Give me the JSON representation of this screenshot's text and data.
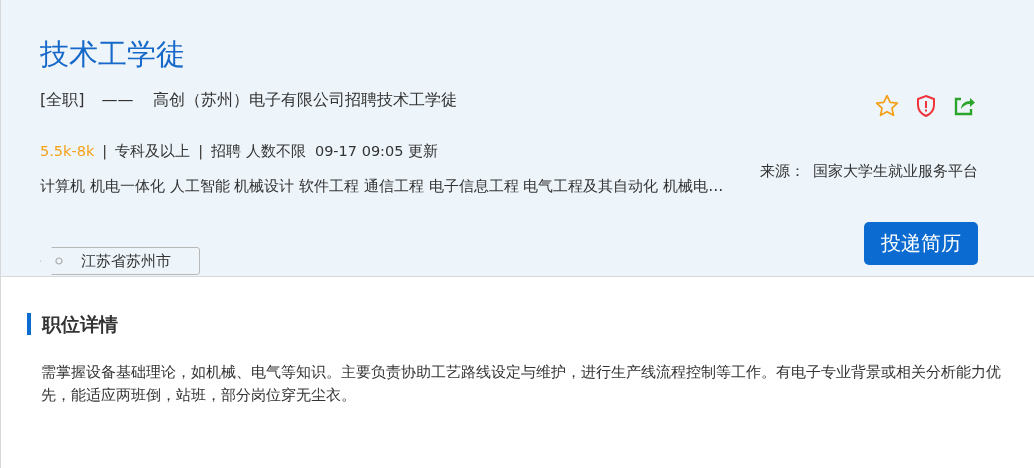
{
  "job": {
    "title": "技术工学徒",
    "type": "[全职]",
    "dash": "——",
    "company_line": "高创（苏州）电子有限公司招聘技术工学徒",
    "salary": "5.5k-8k",
    "meta": [
      "专科及以上",
      "招聘 人数不限  09-17 09:05 更新"
    ],
    "separator": "|",
    "source_label": "来源：",
    "source": "国家大学生就业服务平台",
    "majors": "计算机 机电一体化 人工智能 机械设计 软件工程 通信工程 电子信息工程 电气工程及其自动化 机械电…",
    "location": "江苏省苏州市",
    "apply_button": "投递简历"
  },
  "details": {
    "heading": "职位详情",
    "text": "需掌握设备基础理论，如机械、电气等知识。主要负责协助工艺路线设定与维护，进行生产线流程控制等工作。有电子专业背景或相关分析能力优先，能适应两班倒，站班，部分岗位穿无尘衣。"
  }
}
